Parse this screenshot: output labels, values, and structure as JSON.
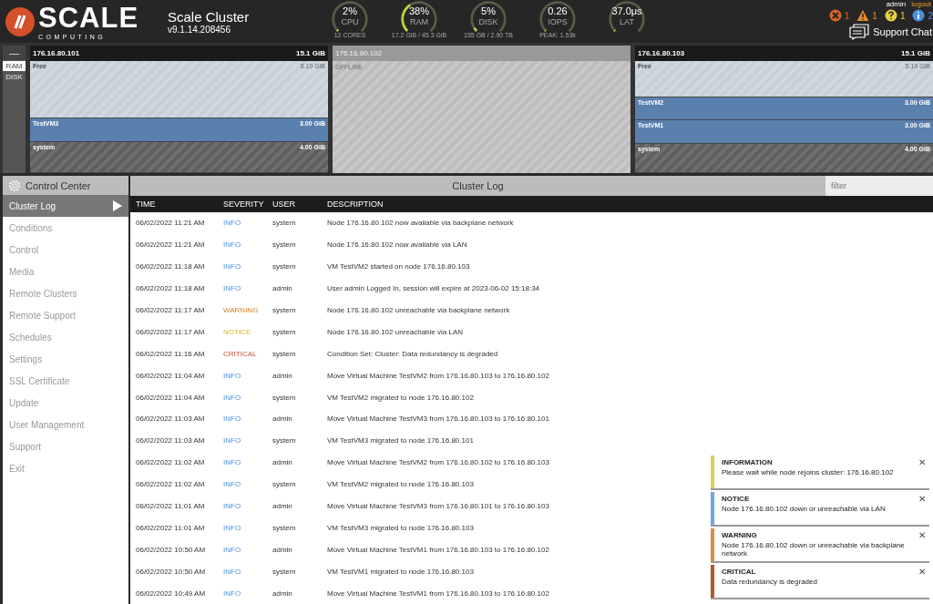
{
  "header": {
    "brand": "SCALE",
    "brand_sub": "COMPUTING",
    "title": "Scale Cluster",
    "version": "v9.1.14.208456",
    "gauges": [
      {
        "value": "2%",
        "label": "CPU",
        "detail": "12 CORES",
        "level": 0.02
      },
      {
        "value": "38%",
        "label": "RAM",
        "detail": "17.2 GiB / 45.3 GiB",
        "level": 0.38
      },
      {
        "value": "5%",
        "label": "DISK",
        "detail": "155 GB / 2.90 TB",
        "level": 0.05
      },
      {
        "value": "0.26",
        "label": "IOPS",
        "detail": "PEAK: 1.53k",
        "level": 0.01
      },
      {
        "value": "37.0μs",
        "label": "LAT",
        "level": 0
      }
    ],
    "user": "admin",
    "logout": "logout",
    "alerts": [
      {
        "kind": "error",
        "count": "1"
      },
      {
        "kind": "warning",
        "count": "1"
      },
      {
        "kind": "question",
        "count": "1"
      },
      {
        "kind": "info",
        "count": "2"
      }
    ],
    "support": "Support Chat"
  },
  "resource_toggle": {
    "collapse": "—",
    "options": [
      {
        "label": "RAM",
        "selected": true
      },
      {
        "label": "DISK",
        "selected": false
      }
    ]
  },
  "nodes": [
    {
      "ip": "176.16.80.101",
      "total": "15.1 GiB",
      "offline": false,
      "segments": [
        {
          "kind": "free",
          "name": "Free",
          "size": "8.10 GiB"
        },
        {
          "kind": "vm",
          "name": "TestVM3",
          "size": "3.00 GiB"
        },
        {
          "kind": "system",
          "name": "system",
          "size": "4.00 GiB"
        }
      ]
    },
    {
      "ip": "176.16.80.102",
      "offline": true,
      "status": "OFFLINE"
    },
    {
      "ip": "176.16.80.103",
      "total": "15.1 GiB",
      "offline": false,
      "segments": [
        {
          "kind": "free",
          "name": "Free",
          "size": "5.10 GiB"
        },
        {
          "kind": "vm",
          "name": "TestVM2",
          "size": "3.00 GiB"
        },
        {
          "kind": "vm",
          "name": "TestVM1",
          "size": "3.00 GiB"
        },
        {
          "kind": "system",
          "name": "system",
          "size": "4.00 GiB"
        }
      ]
    }
  ],
  "sidebar": {
    "title": "Control Center",
    "items": [
      {
        "label": "Cluster Log",
        "selected": true
      },
      {
        "label": "Conditions",
        "selected": false
      },
      {
        "label": "Control",
        "selected": false
      },
      {
        "label": "Media",
        "selected": false
      },
      {
        "label": "Remote Clusters",
        "selected": false
      },
      {
        "label": "Remote Support",
        "selected": false
      },
      {
        "label": "Schedules",
        "selected": false
      },
      {
        "label": "Settings",
        "selected": false
      },
      {
        "label": "SSL Certificate",
        "selected": false
      },
      {
        "label": "Update",
        "selected": false
      },
      {
        "label": "User Management",
        "selected": false
      },
      {
        "label": "Support",
        "selected": false
      },
      {
        "label": "Exit",
        "selected": false
      }
    ]
  },
  "log": {
    "title": "Cluster Log",
    "filter_placeholder": "filter",
    "columns": [
      "TIME",
      "SEVERITY",
      "USER",
      "DESCRIPTION"
    ],
    "rows": [
      {
        "time": "06/02/2022 11:21 AM",
        "severity": "INFO",
        "kind": "info",
        "user": "system",
        "description": "Node 176.16.80.102 now available via backplane network"
      },
      {
        "time": "06/02/2022 11:21 AM",
        "severity": "INFO",
        "kind": "info",
        "user": "system",
        "description": "Node 176.16.80.102 now available via LAN"
      },
      {
        "time": "06/02/2022 11:18 AM",
        "severity": "INFO",
        "kind": "info",
        "user": "system",
        "description": "VM TestVM2 started on node 176.16.80.103"
      },
      {
        "time": "06/02/2022 11:18 AM",
        "severity": "INFO",
        "kind": "info",
        "user": "admin",
        "description": "User admin Logged In, session will expire at 2023-06-02 15:18:34"
      },
      {
        "time": "06/02/2022 11:17 AM",
        "severity": "WARNING",
        "kind": "warning",
        "user": "system",
        "description": "Node 176.16.80.102 unreachable via backplane network"
      },
      {
        "time": "06/02/2022 11:17 AM",
        "severity": "NOTICE",
        "kind": "notice",
        "user": "system",
        "description": "Node 176.16.80.102 unreachable via LAN"
      },
      {
        "time": "06/02/2022 11:16 AM",
        "severity": "CRITICAL",
        "kind": "critical",
        "user": "system",
        "description": "Condition Set: Cluster: Data redundancy is degraded"
      },
      {
        "time": "06/02/2022 11:04 AM",
        "severity": "INFO",
        "kind": "info",
        "user": "admin",
        "description": "Move Virtual Machine TestVM2 from 176.16.80.103 to 176.16.80.102"
      },
      {
        "time": "06/02/2022 11:04 AM",
        "severity": "INFO",
        "kind": "info",
        "user": "system",
        "description": "VM TestVM2 migrated to node 176.16.80.102"
      },
      {
        "time": "06/02/2022 11:03 AM",
        "severity": "INFO",
        "kind": "info",
        "user": "admin",
        "description": "Move Virtual Machine TestVM3 from 176.16.80.103 to 176.16.80.101"
      },
      {
        "time": "06/02/2022 11:03 AM",
        "severity": "INFO",
        "kind": "info",
        "user": "system",
        "description": "VM TestVM3 migrated to node 176.16.80.101"
      },
      {
        "time": "06/02/2022 11:02 AM",
        "severity": "INFO",
        "kind": "info",
        "user": "admin",
        "description": "Move Virtual Machine TestVM2 from 176.16.80.102 to 176.16.80.103"
      },
      {
        "time": "06/02/2022 11:02 AM",
        "severity": "INFO",
        "kind": "info",
        "user": "system",
        "description": "VM TestVM2 migrated to node 176.16.80.103"
      },
      {
        "time": "06/02/2022 11:01 AM",
        "severity": "INFO",
        "kind": "info",
        "user": "admin",
        "description": "Move Virtual Machine TestVM3 from 176.16.80.101 to 176.16.80.103"
      },
      {
        "time": "06/02/2022 11:01 AM",
        "severity": "INFO",
        "kind": "info",
        "user": "system",
        "description": "VM TestVM3 migrated to node 176.16.80.103"
      },
      {
        "time": "06/02/2022 10:50 AM",
        "severity": "INFO",
        "kind": "info",
        "user": "admin",
        "description": "Move Virtual Machine TestVM1 from 176.16.80.103 to 176.16.80.102"
      },
      {
        "time": "06/02/2022 10:50 AM",
        "severity": "INFO",
        "kind": "info",
        "user": "system",
        "description": "VM TestVM1 migrated to node 176.16.80.103"
      },
      {
        "time": "06/02/2022 10:49 AM",
        "severity": "INFO",
        "kind": "info",
        "user": "admin",
        "description": "Move Virtual Machine TestVM1 from 176.16.80.103 to 176.16.80.102"
      }
    ]
  },
  "notifications": [
    {
      "title": "INFORMATION",
      "message": "Please wait while node rejoins cluster: 176.16.80.102",
      "color": "#e0d050",
      "close": "✕"
    },
    {
      "title": "NOTICE",
      "message": "Node 176.16.80.102 down or unreachable via LAN",
      "color": "#6aa8e8",
      "close": "✕"
    },
    {
      "title": "WARNING",
      "message": "Node 176.16.80.102 down or unreachable via backplane network",
      "color": "#e08a3a",
      "close": "✕"
    },
    {
      "title": "CRITICAL",
      "message": "Data redundancy is degraded",
      "color": "#b8552a",
      "close": "✕"
    }
  ]
}
